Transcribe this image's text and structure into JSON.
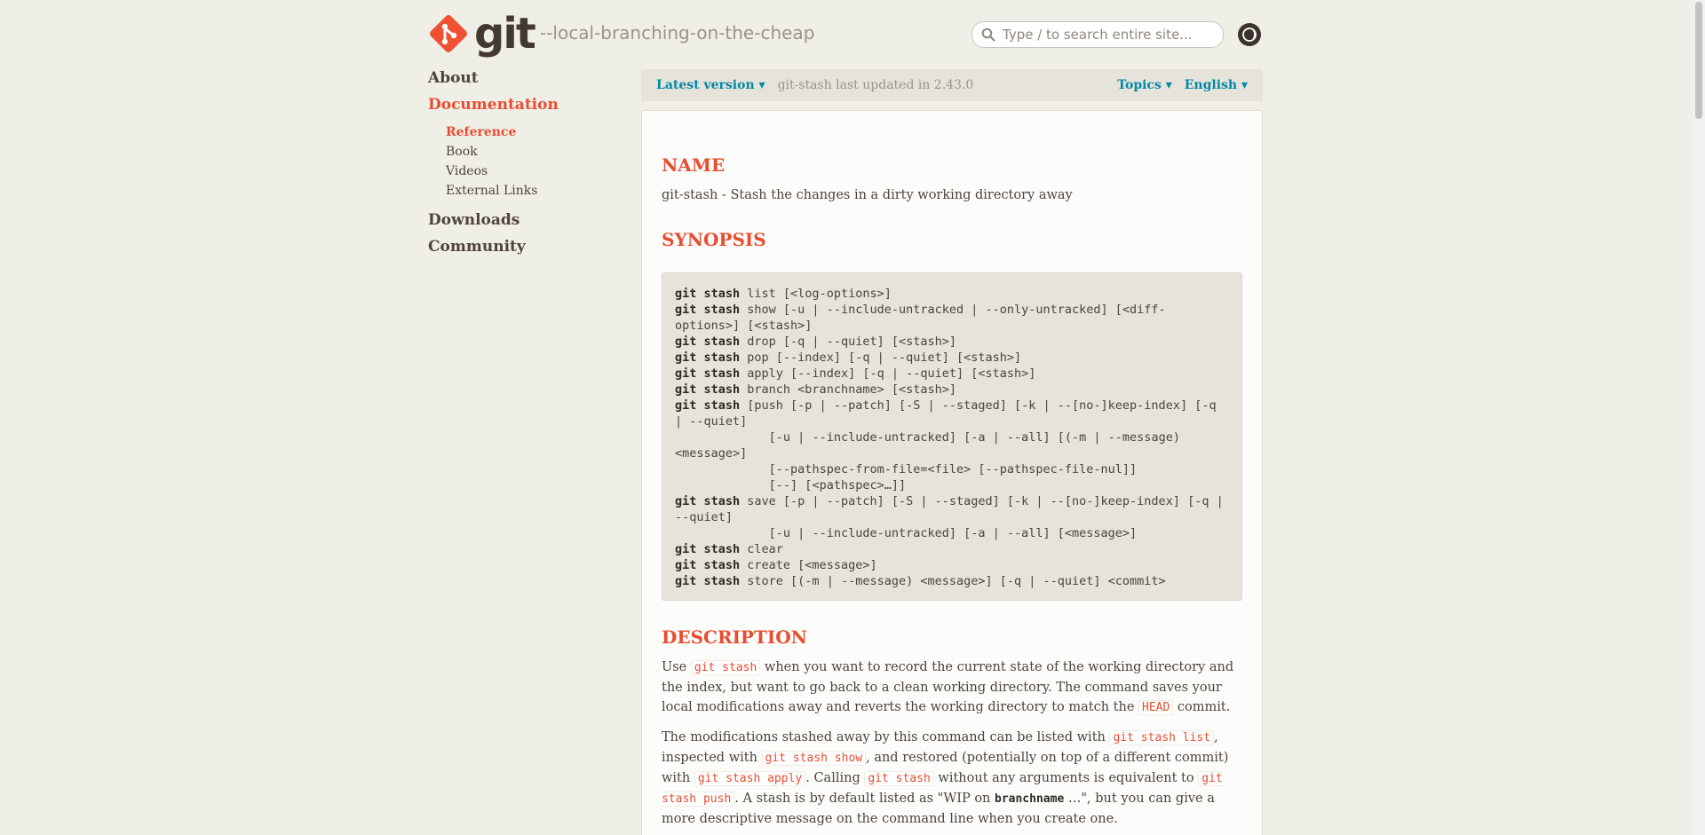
{
  "header": {
    "logo_text": "git",
    "tagline": "--local-branching-on-the-cheap",
    "search_placeholder": "Type / to search entire site..."
  },
  "sidebar": {
    "items": [
      {
        "label": "About"
      },
      {
        "label": "Documentation",
        "active": true
      },
      {
        "label": "Downloads"
      },
      {
        "label": "Community"
      }
    ],
    "doc_sub": [
      {
        "label": "Reference",
        "active": true
      },
      {
        "label": "Book"
      },
      {
        "label": "Videos"
      },
      {
        "label": "External Links"
      }
    ]
  },
  "topbar": {
    "version": "Latest version ▾",
    "updated": "git-stash last updated in 2.43.0",
    "topics": "Topics ▾",
    "language": "English ▾"
  },
  "content": {
    "name_heading": "NAME",
    "name_text": "git-stash - Stash the changes in a dirty working directory away",
    "synopsis_heading": "SYNOPSIS",
    "synopsis_cmd": "git stash",
    "synopsis_lines": [
      {
        "cmd": true,
        "args": " list [<log-options>]"
      },
      {
        "cmd": true,
        "args": " show [-u | --include-untracked | --only-untracked] [<diff-options>] [<stash>]"
      },
      {
        "cmd": true,
        "args": " drop [-q | --quiet] [<stash>]"
      },
      {
        "cmd": true,
        "args": " pop [--index] [-q | --quiet] [<stash>]"
      },
      {
        "cmd": true,
        "args": " apply [--index] [-q | --quiet] [<stash>]"
      },
      {
        "cmd": true,
        "args": " branch <branchname> [<stash>]"
      },
      {
        "cmd": true,
        "args": " [push [-p | --patch] [-S | --staged] [-k | --[no-]keep-index] [-q | --quiet]"
      },
      {
        "cmd": false,
        "args": "             [-u | --include-untracked] [-a | --all] [(-m | --message) <message>]"
      },
      {
        "cmd": false,
        "args": "             [--pathspec-from-file=<file> [--pathspec-file-nul]]"
      },
      {
        "cmd": false,
        "args": "             [--] [<pathspec>…]]"
      },
      {
        "cmd": true,
        "args": " save [-p | --patch] [-S | --staged] [-k | --[no-]keep-index] [-q | --quiet]"
      },
      {
        "cmd": false,
        "args": "             [-u | --include-untracked] [-a | --all] [<message>]"
      },
      {
        "cmd": true,
        "args": " clear"
      },
      {
        "cmd": true,
        "args": " create [<message>]"
      },
      {
        "cmd": true,
        "args": " store [(-m | --message) <message>] [-q | --quiet] <commit>"
      }
    ],
    "description_heading": "DESCRIPTION",
    "desc_p1": {
      "t1": "Use ",
      "c1": "git stash",
      "t2": " when you want to record the current state of the working directory and the index, but want to go back to a clean working directory. The command saves your local modifications away and reverts the working directory to match the ",
      "c2": "HEAD",
      "t3": " commit."
    },
    "desc_p2": {
      "t1": "The modifications stashed away by this command can be listed with ",
      "c1": "git stash list",
      "t2": ", inspected with ",
      "c2": "git stash show",
      "t3": ", and restored (potentially on top of a different commit) with ",
      "c3": "git stash apply",
      "t4": ". Calling ",
      "c4": "git stash",
      "t5": " without any arguments is equivalent to ",
      "c5": "git stash push",
      "t6": ". A stash is by default listed as \"WIP on ",
      "b1": "branchname",
      "t7": " …\", but you can give a more descriptive message on the command line when you create one."
    }
  },
  "colors": {
    "accent": "#e84d31",
    "link": "#0388a6",
    "background": "#f0efe7"
  }
}
